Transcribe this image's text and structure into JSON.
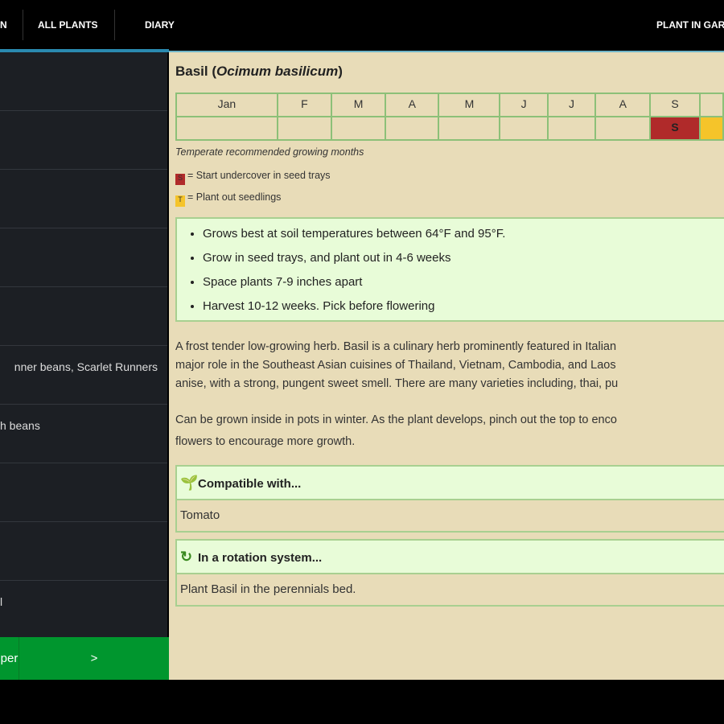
{
  "tabs": [
    "N",
    "ALL PLANTS",
    "DIARY",
    "PLANT IN GARDEN"
  ],
  "sidebar": {
    "items": [
      "",
      "",
      "",
      "",
      "",
      "nner beans, Scarlet Runners",
      "h beans",
      "",
      "",
      "l"
    ],
    "buttons": {
      "prev": "per",
      "next": ">"
    }
  },
  "plant": {
    "name": "Basil",
    "latin": "Ocimum basilicum"
  },
  "calendar": {
    "months": [
      "Jan",
      "F",
      "M",
      "A",
      "M",
      "J",
      "J",
      "A",
      "S",
      ""
    ],
    "sow_mark": "S",
    "colors": {
      "sow": "#b02a2a",
      "plant": "#f5c42a"
    }
  },
  "legend": {
    "caption": "Temperate recommended growing months",
    "sow": "= Start undercover in seed trays",
    "plant": "= Plant out seedlings",
    "sow_key": "S",
    "plant_key": "T"
  },
  "tips": [
    "Grows best at soil temperatures between 64°F and 95°F.",
    "Grow in seed trays, and plant out in 4-6 weeks",
    "Space plants 7-9 inches apart",
    "Harvest 10-12 weeks. Pick before flowering"
  ],
  "description": [
    "A frost tender low-growing herb. Basil is a culinary herb prominently featured in Italian",
    "major role in the Southeast Asian cuisines of Thailand, Vietnam, Cambodia, and Laos",
    "anise, with a strong, pungent sweet smell. There are many varieties including, thai, pu"
  ],
  "description2": [
    "Can be grown inside in pots in winter. As the plant develops, pinch out the top to enco",
    "flowers to encourage more growth."
  ],
  "compatible": {
    "title": "Compatible with...",
    "body": "Tomato"
  },
  "rotation": {
    "title": "In a rotation system...",
    "body": "Plant Basil in the perennials bed."
  }
}
